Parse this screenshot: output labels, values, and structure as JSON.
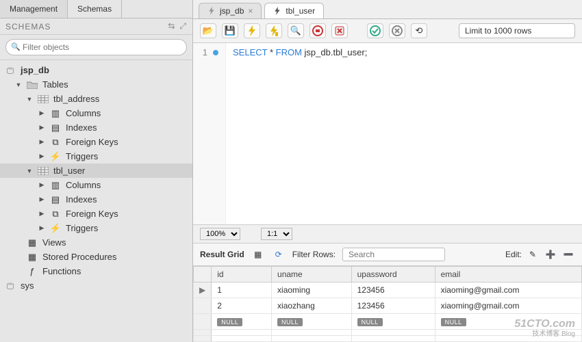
{
  "sidebar": {
    "tabs": [
      "Management",
      "Schemas"
    ],
    "activeTab": 1,
    "title": "SCHEMAS",
    "filter_placeholder": "Filter objects",
    "tree": {
      "db": "jsp_db",
      "tables_label": "Tables",
      "tables": [
        {
          "name": "tbl_address",
          "children": [
            "Columns",
            "Indexes",
            "Foreign Keys",
            "Triggers"
          ]
        },
        {
          "name": "tbl_user",
          "children": [
            "Columns",
            "Indexes",
            "Foreign Keys",
            "Triggers"
          ]
        }
      ],
      "views": "Views",
      "stored_procedures": "Stored Procedures",
      "functions": "Functions",
      "other_db": "sys"
    }
  },
  "tabs": [
    {
      "label": "jsp_db",
      "active": false
    },
    {
      "label": "tbl_user",
      "active": true
    }
  ],
  "toolbar": {
    "limit_label": "Limit to 1000 rows"
  },
  "editor": {
    "line_no": "1",
    "kw_select": "SELECT",
    "star": " * ",
    "kw_from": "FROM",
    "target": " jsp_db.tbl_user;"
  },
  "status": {
    "zoom": "100%",
    "split": "1:1"
  },
  "results": {
    "title": "Result Grid",
    "filter_label": "Filter Rows:",
    "search_placeholder": "Search",
    "edit_label": "Edit:",
    "columns": [
      "id",
      "uname",
      "upassword",
      "email"
    ],
    "rows": [
      {
        "id": "1",
        "uname": "xiaoming",
        "upassword": "123456",
        "email": "xiaoming@gmail.com"
      },
      {
        "id": "2",
        "uname": "xiaozhang",
        "upassword": "123456",
        "email": "xiaoming@gmail.com"
      }
    ],
    "null_label": "NULL"
  },
  "watermark": {
    "line1": "51CTO.com",
    "line2": "技术博客  Blog"
  }
}
